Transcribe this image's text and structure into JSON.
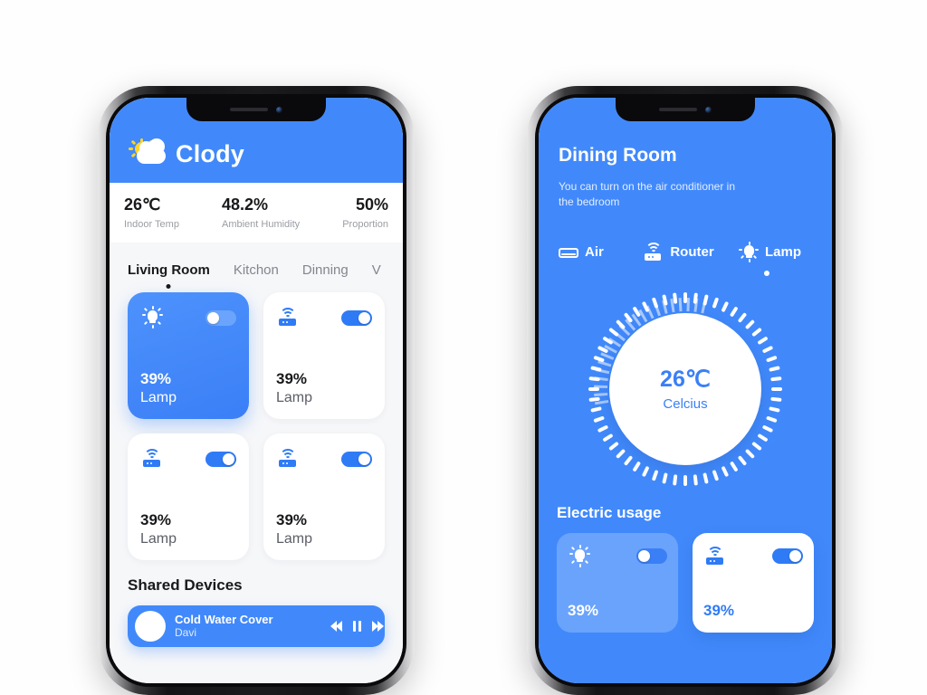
{
  "left": {
    "header": {
      "title": "Clody",
      "weather_icon": "sun-cloud-icon"
    },
    "stats": [
      {
        "value": "26℃",
        "label": "Indoor Temp"
      },
      {
        "value": "48.2%",
        "label": "Ambient Humidity"
      },
      {
        "value": "50%",
        "label": "Proportion"
      }
    ],
    "tabs": [
      {
        "label": "Living Room",
        "active": true
      },
      {
        "label": "Kitchon",
        "active": false
      },
      {
        "label": "Dinning",
        "active": false
      },
      {
        "label": "V",
        "active": false
      }
    ],
    "devices": [
      {
        "icon": "lamp-icon",
        "percent": "39%",
        "name": "Lamp",
        "toggle": "off",
        "selected": true
      },
      {
        "icon": "router-icon",
        "percent": "39%",
        "name": "Lamp",
        "toggle": "on",
        "selected": false
      },
      {
        "icon": "router-icon",
        "percent": "39%",
        "name": "Lamp",
        "toggle": "on",
        "selected": false
      },
      {
        "icon": "router-icon",
        "percent": "39%",
        "name": "Lamp",
        "toggle": "on",
        "selected": false
      }
    ],
    "shared": {
      "title": "Shared Devices",
      "player": {
        "track": "Cold Water Cover",
        "artist": "Davi",
        "rewind": "rewind-icon",
        "pause": "pause-icon",
        "forward": "fast-forward-icon"
      }
    }
  },
  "right": {
    "title": "Dining Room",
    "subtitle": "You can turn on the air conditioner in the bedroom",
    "tabs": [
      {
        "label": "Air",
        "icon": "air-conditioner-icon",
        "active": false
      },
      {
        "label": "Router",
        "icon": "router-icon",
        "active": false
      },
      {
        "label": "Lamp",
        "icon": "lamp-icon",
        "active": true
      }
    ],
    "dial": {
      "temperature": "26℃",
      "unit": "Celcius"
    },
    "electric": {
      "title": "Electric usage",
      "cards": [
        {
          "icon": "lamp-icon",
          "percent": "39%",
          "toggle": "off",
          "style": "light"
        },
        {
          "icon": "router-icon",
          "percent": "39%",
          "toggle": "on",
          "style": "white"
        }
      ]
    }
  },
  "colors": {
    "brand_blue": "#4189FB",
    "card_light_blue": "#6AA3FC",
    "text_dark": "#18191B",
    "muted": "#9B9DA3"
  }
}
